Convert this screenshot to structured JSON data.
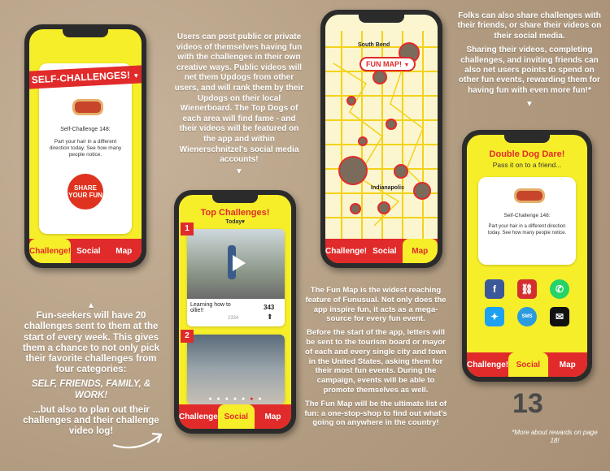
{
  "phone1": {
    "banner": "SELF-CHALLENGES!",
    "challenge_title": "Self-Challenge 148:",
    "challenge_body": "Part your hair in a different direction today. See how many people notice.",
    "share_label": "SHARE YOUR FUN",
    "tabs": [
      "Challenge!",
      "Social",
      "Map"
    ]
  },
  "phone2": {
    "header": "Top Challenges!",
    "sub": "Today",
    "rank1": "1",
    "rank2": "2",
    "caption": "Learning how to ollie!!",
    "caption_count": "2334",
    "updogs": "343",
    "tabs": [
      "Challenge",
      "Social",
      "Map"
    ]
  },
  "phone3": {
    "badge": "FUN MAP!",
    "city1": "South Bend",
    "city2": "Indianapolis",
    "tabs": [
      "Challenge!",
      "Social",
      "Map"
    ]
  },
  "phone4": {
    "title": "Double Dog Dare!",
    "subtitle": "Pass it on to a friend...",
    "challenge_title": "Self-Challenge 148:",
    "challenge_body": "Part your hair in a different direction today. See how many people notice.",
    "sms": "SMS",
    "tabs": [
      "Challenge!",
      "Social",
      "Map"
    ]
  },
  "text": {
    "p1": "Users can post public or private videos of themselves having fun with the challenges in their own creative ways. Public videos will net them Updogs from other users, and will rank them by their Updogs on their local Wienerboard. The Top Dogs of each area will find fame - and their videos will be featured on the app and within Wienerschnitzel's social media accounts!",
    "p2a": "Fun-seekers will have 20 challenges sent to them at the start of every week. This gives them a chance to not only pick their favorite challenges from four categories:",
    "p2b": "SELF, FRIENDS, FAMILY, & WORK!",
    "p2c": "...but also to plan out their challenges and their challenge video log!",
    "p3a": "The Fun Map is the widest reaching feature of Funusual. Not only does the app inspire fun, it acts as a mega-source for every fun event.",
    "p3b": "Before the start of the app, letters will be sent to the tourism board or mayor of each and every single city and town in the United States, asking them for their most fun events. During the campaign, events will be able to promote themselves as well.",
    "p3c": "The Fun Map will be the ultimate list of fun: a one-stop-shop to find out what's going on anywhere in the country!",
    "p4a": "Folks can also share challenges with their friends, or share their videos on their social media.",
    "p4b": "Sharing their videos, completing challenges, and inviting friends can also net users points to spend on other fun events, rewarding them for having fun with even more fun!*"
  },
  "page_number": "13",
  "footnote": "*More about rewards on page 18!",
  "colors": {
    "yellow": "#f7ee2a",
    "red": "#e12b2b"
  }
}
